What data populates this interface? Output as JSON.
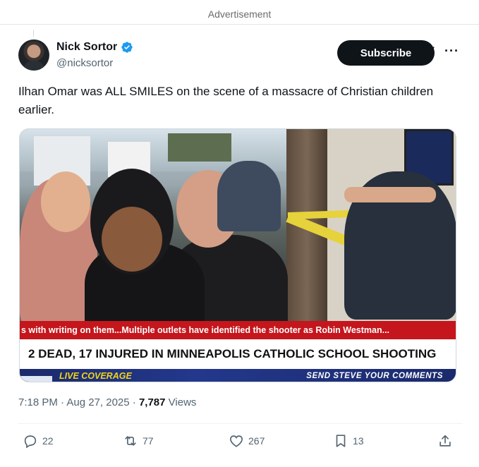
{
  "advertisement_label": "Advertisement",
  "author": {
    "display_name": "Nick Sortor",
    "handle": "@nicksortor",
    "verified": true
  },
  "subscribe_label": "Subscribe",
  "tweet_text": "Ilhan Omar was ALL SMILES on the scene of a massacre of Christian children earlier.",
  "media": {
    "ticker_text": "s with writing on them...Multiple outlets have identified the shooter as Robin Westman...",
    "headline": "2 DEAD, 17 INJURED IN MINNEAPOLIS CATHOLIC SCHOOL SHOOTING",
    "live_label": "LIVE COVERAGE",
    "send_label": "SEND STEVE YOUR COMMENTS"
  },
  "meta": {
    "time_date": "7:18 PM · Aug 27, 2025 · ",
    "views_count": "7,787",
    "views_label": " Views"
  },
  "actions": {
    "replies": "22",
    "reposts": "77",
    "likes": "267",
    "bookmarks": "13"
  },
  "colors": {
    "verified": "#1d9bf0",
    "ticker_red": "#c4161c",
    "bar_blue": "#1b2a6b",
    "live_yellow": "#f0d419"
  },
  "icons": [
    "verified-badge-icon",
    "grok-icon",
    "more-icon",
    "reply-icon",
    "repost-icon",
    "like-icon",
    "bookmark-icon",
    "share-icon"
  ]
}
